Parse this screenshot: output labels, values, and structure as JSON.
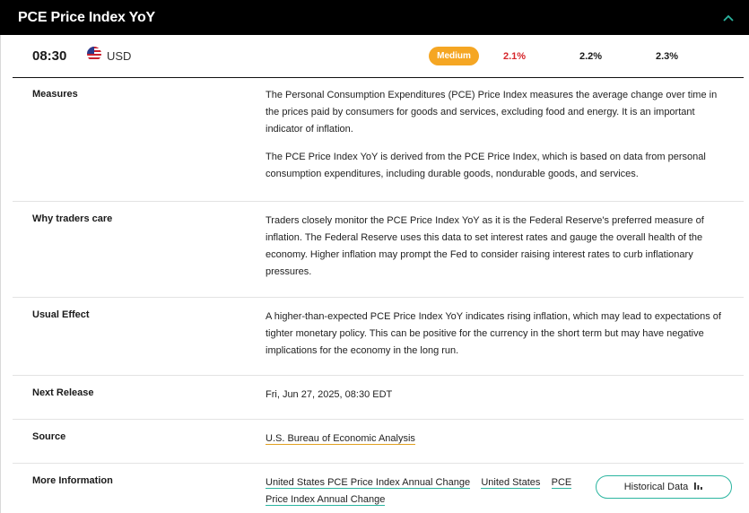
{
  "header": {
    "title": "PCE Price Index YoY"
  },
  "event": {
    "time": "08:30",
    "currency": "USD",
    "impact": "Medium",
    "actual": "2.1%",
    "forecast": "2.2%",
    "previous": "2.3%"
  },
  "details": {
    "measures": {
      "label": "Measures",
      "p1": "The Personal Consumption Expenditures (PCE) Price Index measures the average change over time in the prices paid by consumers for goods and services, excluding food and energy. It is an important indicator of inflation.",
      "p2": "The PCE Price Index YoY is derived from the PCE Price Index, which is based on data from personal consumption expenditures, including durable goods, nondurable goods, and services."
    },
    "why": {
      "label": "Why traders care",
      "text": "Traders closely monitor the PCE Price Index YoY as it is the Federal Reserve's preferred measure of inflation. The Federal Reserve uses this data to set interest rates and gauge the overall health of the economy. Higher inflation may prompt the Fed to consider raising interest rates to curb inflationary pressures."
    },
    "effect": {
      "label": "Usual Effect",
      "text": "A higher-than-expected PCE Price Index YoY indicates rising inflation, which may lead to expectations of tighter monetary policy. This can be positive for the currency in the short term but may have negative implications for the economy in the long run."
    },
    "next_release": {
      "label": "Next Release",
      "text": "Fri, Jun 27, 2025, 08:30 EDT"
    },
    "source": {
      "label": "Source",
      "link": "U.S. Bureau of Economic Analysis"
    },
    "more_info": {
      "label": "More Information",
      "links": [
        "United States PCE Price Index Annual Change",
        "United States",
        "PCE",
        "Price Index Annual Change"
      ]
    }
  },
  "historical_button": "Historical Data",
  "icons": {
    "collapse": "chevron-up-icon",
    "flag": "us-flag-icon",
    "chart": "bar-chart-icon"
  },
  "colors": {
    "header_bg": "#000000",
    "medium_badge": "#f5a623",
    "actual_red": "#d6262b",
    "accent_teal": "#2bb5a0",
    "chevron": "#2bb5a0"
  }
}
